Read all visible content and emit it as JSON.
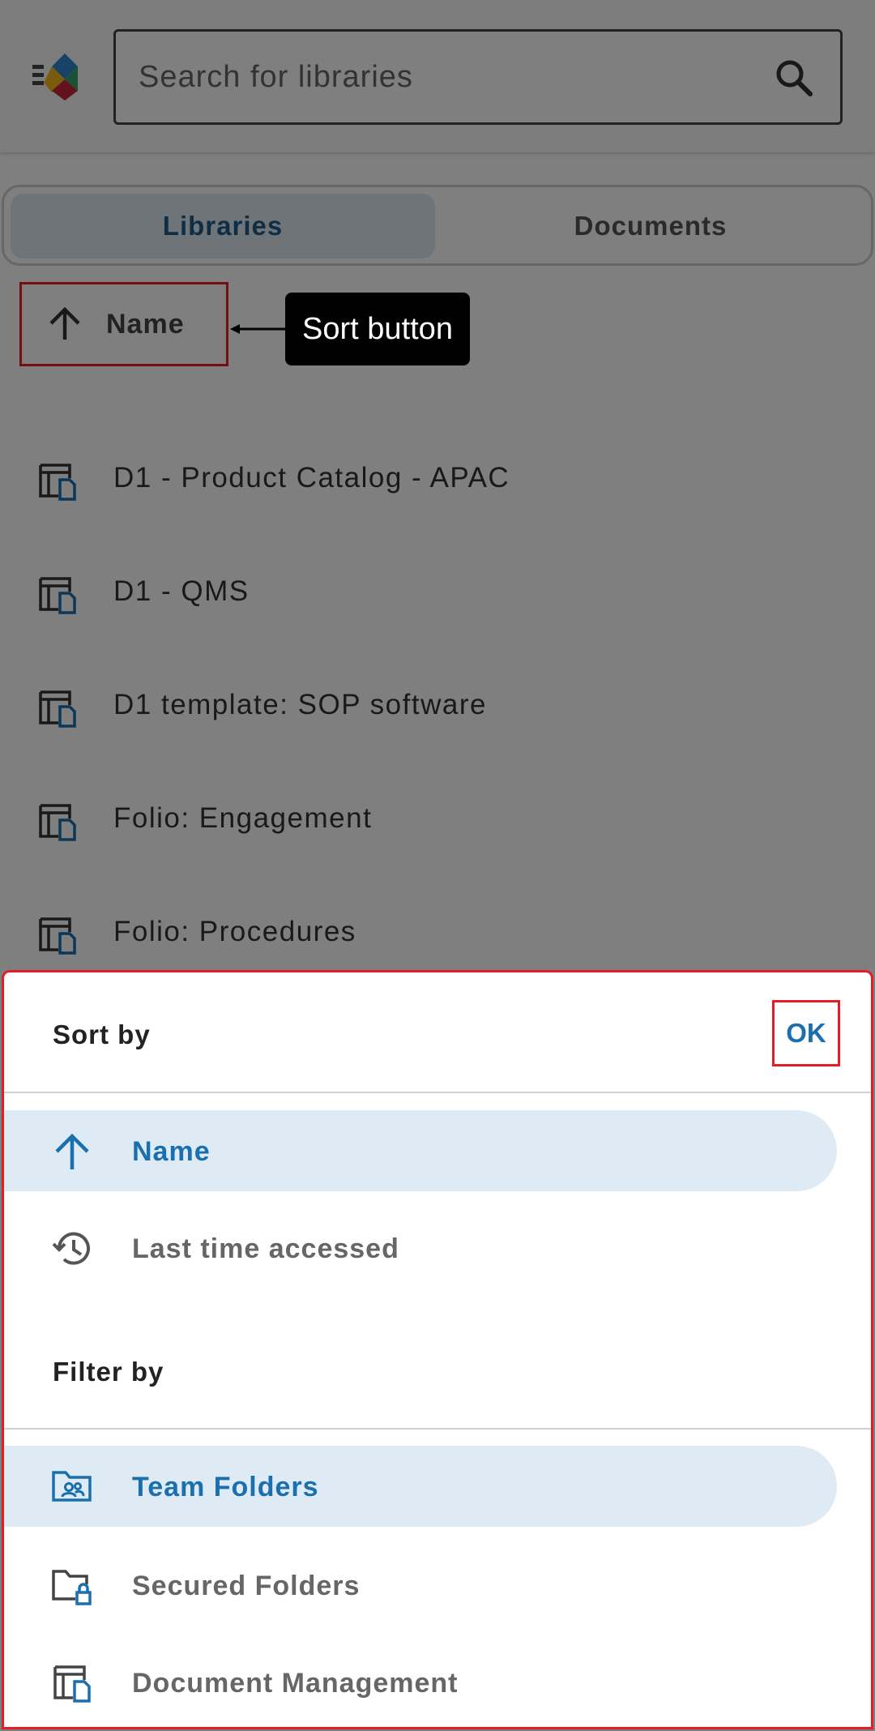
{
  "search": {
    "placeholder": "Search for libraries"
  },
  "tabs": [
    {
      "label": "Libraries",
      "active": true
    },
    {
      "label": "Documents",
      "active": false
    }
  ],
  "sort_chip": {
    "label": "Name"
  },
  "annotation": {
    "text": "Sort button"
  },
  "libraries": [
    {
      "name": "D1 - Product Catalog - APAC",
      "icon": "library-icon"
    },
    {
      "name": "D1 - QMS",
      "icon": "library-icon"
    },
    {
      "name": "D1 template: SOP software",
      "icon": "library-icon"
    },
    {
      "name": "Folio: Engagement",
      "icon": "library-icon"
    },
    {
      "name": "Folio: Procedures",
      "icon": "library-icon"
    }
  ],
  "sheet": {
    "sort_title": "Sort by",
    "ok_label": "OK",
    "sort_options": [
      {
        "label": "Name",
        "icon": "arrow-up-icon",
        "selected": true
      },
      {
        "label": "Last time accessed",
        "icon": "history-icon",
        "selected": false
      }
    ],
    "filter_title": "Filter by",
    "filter_options": [
      {
        "label": "Team Folders",
        "icon": "team-folder-icon",
        "selected": true
      },
      {
        "label": "Secured Folders",
        "icon": "secured-folder-icon",
        "selected": false
      },
      {
        "label": "Document Management",
        "icon": "library-icon",
        "selected": false
      }
    ]
  },
  "colors": {
    "accent": "#1a6fae",
    "highlight": "#e41e25",
    "selected_bg": "#deeaf4"
  }
}
